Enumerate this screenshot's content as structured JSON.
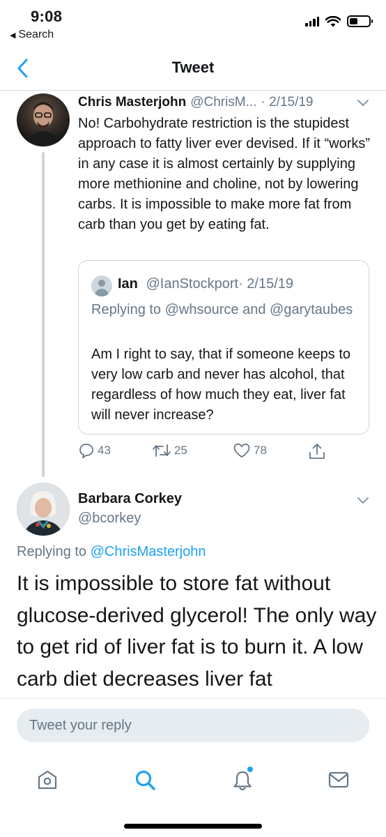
{
  "status_bar": {
    "time": "9:08",
    "back_label": "Search"
  },
  "nav": {
    "title": "Tweet"
  },
  "tweet": {
    "name": "Chris Masterjohn",
    "handle": "@ChrisM...",
    "date": "· 2/15/19",
    "body": "No! Carbohydrate restriction is the stupidest approach to fatty liver ever devised. If it “works” in any case it is almost certainly by supplying more methionine and choline, not by lowering carbs. It is impossible to make more fat from carb than you get by eating fat.",
    "quoted": {
      "name": "Ian",
      "handle": "@IanStockport",
      "date": "· 2/15/19",
      "reply_prefix": "Replying to",
      "reply_mention_1": "@whsource",
      "reply_and": "and",
      "reply_mention_2": "@garytaubes",
      "body": "Am I right to say, that if someone keeps to very low carb and never has alcohol, that regardless of how much they eat, liver fat will never increase?"
    },
    "actions": {
      "replies": "43",
      "retweets": "25",
      "likes": "78"
    }
  },
  "reply_tweet": {
    "name": "Barbara Corkey",
    "handle": "@bcorkey",
    "reply_prefix": "Replying to",
    "reply_mention": "@ChrisMasterjohn",
    "body": "It is impossible to store fat without glucose-derived glycerol!  The only way to get rid of liver fat is to burn it.  A low carb diet decreases liver fat"
  },
  "compose": {
    "placeholder": "Tweet your reply"
  },
  "tabs": [
    {
      "icon": "home-icon"
    },
    {
      "icon": "search-icon"
    },
    {
      "icon": "notifications-icon"
    },
    {
      "icon": "messages-icon"
    }
  ],
  "colors": {
    "accent": "#1da1f2",
    "secondary_text": "#657786",
    "primary_text": "#14171a"
  }
}
